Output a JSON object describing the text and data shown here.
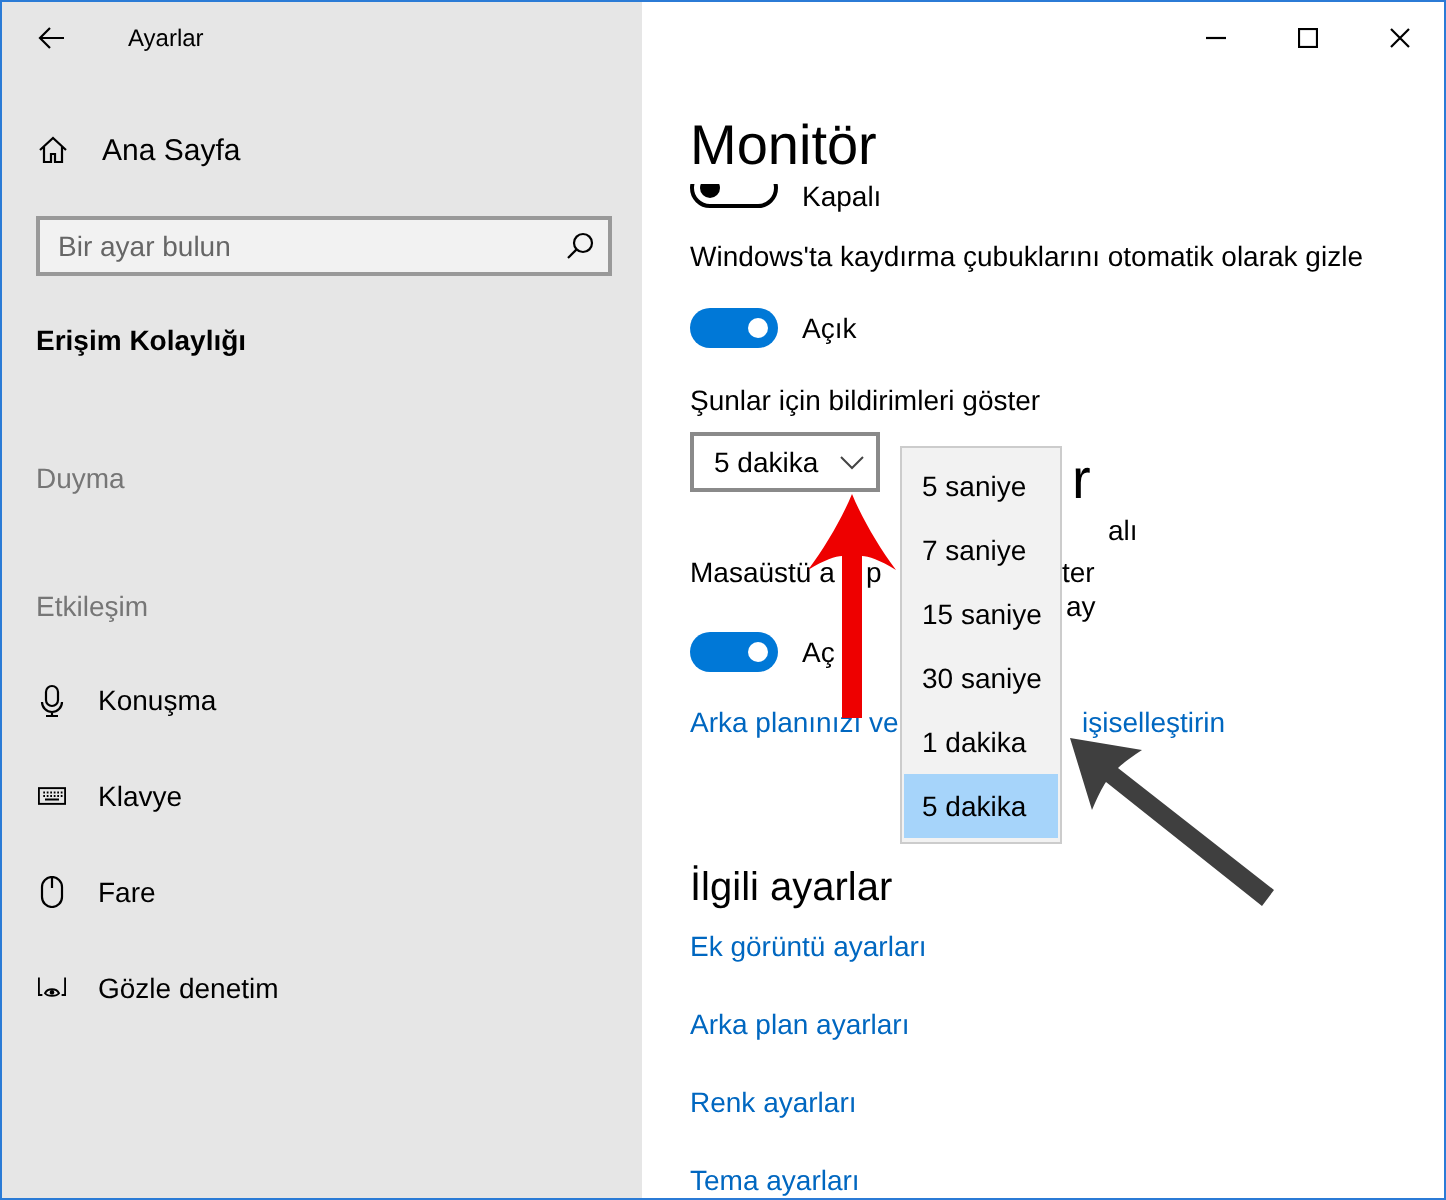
{
  "window": {
    "title": "Ayarlar"
  },
  "sidebar": {
    "home": "Ana Sayfa",
    "search": {
      "placeholder": "Bir ayar bulun"
    },
    "section_title": "Erişim Kolaylığı",
    "items": [
      {
        "kind": "category",
        "label": "Duyma"
      },
      {
        "kind": "category",
        "label": "Etkileşim"
      },
      {
        "kind": "item",
        "label": "Konuşma"
      },
      {
        "kind": "item",
        "label": "Klavye"
      },
      {
        "kind": "item",
        "label": "Fare"
      },
      {
        "kind": "item",
        "label": "Gözle denetim"
      }
    ]
  },
  "content": {
    "title": "Monitör",
    "settings": [
      {
        "kind": "toggle",
        "on": false,
        "state": "Kapalı"
      },
      {
        "kind": "label",
        "text": "Windows'ta kaydırma çubuklarını otomatik olarak gizle"
      },
      {
        "kind": "toggle",
        "on": true,
        "state": "Açık"
      },
      {
        "kind": "label",
        "text": "Şunlar için bildirimleri göster"
      },
      {
        "kind": "dropdown",
        "value": "5 dakika",
        "expanded": true,
        "options": [
          {
            "label": "5 saniye",
            "selected": false
          },
          {
            "label": "7 saniye",
            "selected": false
          },
          {
            "label": "15 saniye",
            "selected": false
          },
          {
            "label": "30 saniye",
            "selected": false
          },
          {
            "label": "1 dakika",
            "selected": false
          },
          {
            "label": "5 dakika",
            "selected": true
          }
        ]
      },
      {
        "kind": "covered-heading",
        "parts": [
          "r"
        ]
      },
      {
        "kind": "covered-text",
        "parts": [
          "alı"
        ]
      },
      {
        "kind": "covered-text",
        "parts": [
          "Masaüstü a",
          "p",
          "ter"
        ]
      },
      {
        "kind": "covered-text",
        "parts": [
          "ay"
        ]
      },
      {
        "kind": "toggle",
        "on": true,
        "state": "Aç"
      },
      {
        "kind": "covered-link",
        "parts": [
          "Arka planınızı ve",
          "işiselleştirin"
        ]
      }
    ]
  },
  "related": {
    "title": "İlgili ayarlar",
    "links": [
      "Ek görüntü ayarları",
      "Arka plan ayarları",
      "Renk ayarları",
      "Tema ayarları"
    ]
  }
}
